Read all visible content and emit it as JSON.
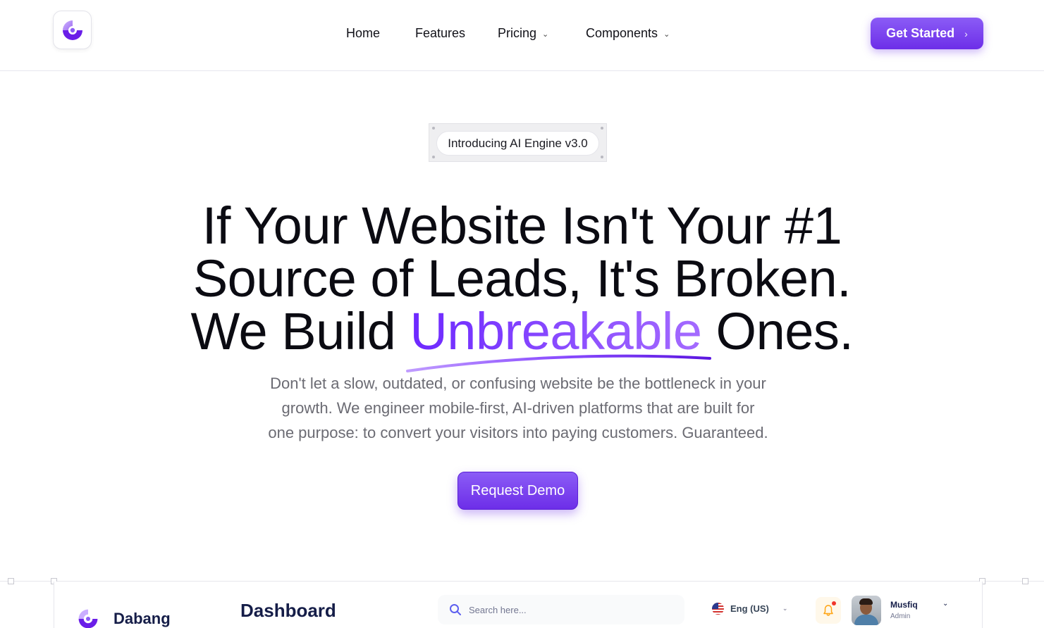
{
  "brand": {
    "logo_icon": "half-ring-logo-icon",
    "accent_color": "#7c3aed"
  },
  "nav": {
    "items": [
      {
        "label": "Home",
        "has_dropdown": false
      },
      {
        "label": "Features",
        "has_dropdown": false
      },
      {
        "label": "Pricing",
        "has_dropdown": true
      },
      {
        "label": "Components",
        "has_dropdown": true
      }
    ],
    "cta_label": "Get Started"
  },
  "hero": {
    "badge": "Introducing AI Engine v3.0",
    "title_line1": "If Your Website Isn't Your #1",
    "title_line2": "Source of Leads, It's Broken.",
    "title_line3_prefix": "We Build ",
    "title_accent": "Unbreakable",
    "title_line3_suffix": " Ones.",
    "subtitle_line1": "Don't let a slow, outdated, or confusing website be the bottleneck in your",
    "subtitle_line2": "growth. We engineer mobile-first, AI-driven platforms that are built for",
    "subtitle_line3": "one purpose: to convert your visitors into paying customers. Guaranteed.",
    "cta_label": "Request Demo"
  },
  "dashboard_preview": {
    "brand": "Dabang",
    "title": "Dashboard",
    "search_placeholder": "Search here...",
    "language": "Eng (US)",
    "user_name": "Musfiq",
    "user_role": "Admin",
    "notification_dot_color": "#f0362b"
  }
}
